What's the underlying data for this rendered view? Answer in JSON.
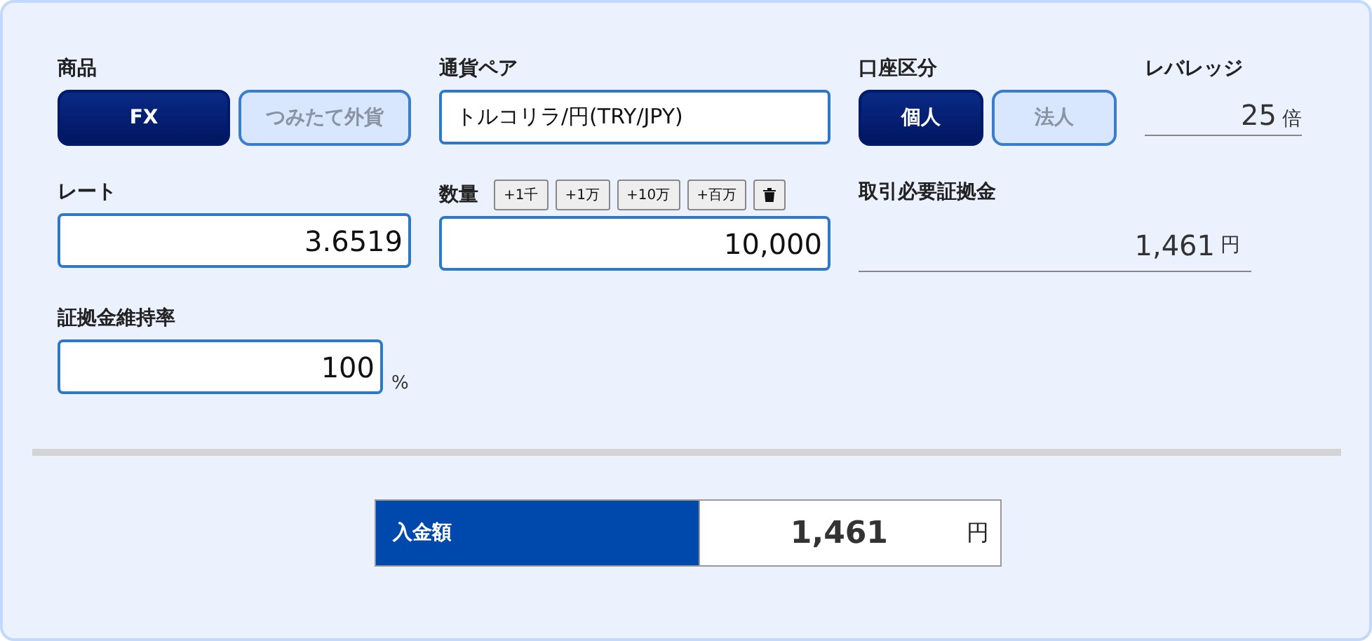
{
  "product": {
    "label": "商品",
    "options": [
      {
        "label": "FX",
        "selected": true
      },
      {
        "label": "つみたて外貨",
        "selected": false
      }
    ]
  },
  "currency_pair": {
    "label": "通貨ペア",
    "value": "トルコリラ/円(TRY/JPY)"
  },
  "account_type": {
    "label": "口座区分",
    "options": [
      {
        "label": "個人",
        "selected": true
      },
      {
        "label": "法人",
        "selected": false
      }
    ]
  },
  "leverage": {
    "label": "レバレッジ",
    "value": "25",
    "unit": "倍"
  },
  "rate": {
    "label": "レート",
    "value": "3.6519"
  },
  "quantity": {
    "label": "数量",
    "buttons": [
      {
        "kind": "text",
        "label": "+1千"
      },
      {
        "kind": "text",
        "label": "+1万"
      },
      {
        "kind": "text",
        "label": "+10万"
      },
      {
        "kind": "text",
        "label": "+百万"
      },
      {
        "kind": "trash"
      }
    ],
    "value": "10,000"
  },
  "required_margin": {
    "label": "取引必要証拠金",
    "value": "1,461",
    "unit": "円"
  },
  "maintenance_rate": {
    "label": "証拠金維持率",
    "value": "100",
    "unit": "%"
  },
  "deposit": {
    "label": "入金額",
    "value": "1,461",
    "unit": "円"
  }
}
